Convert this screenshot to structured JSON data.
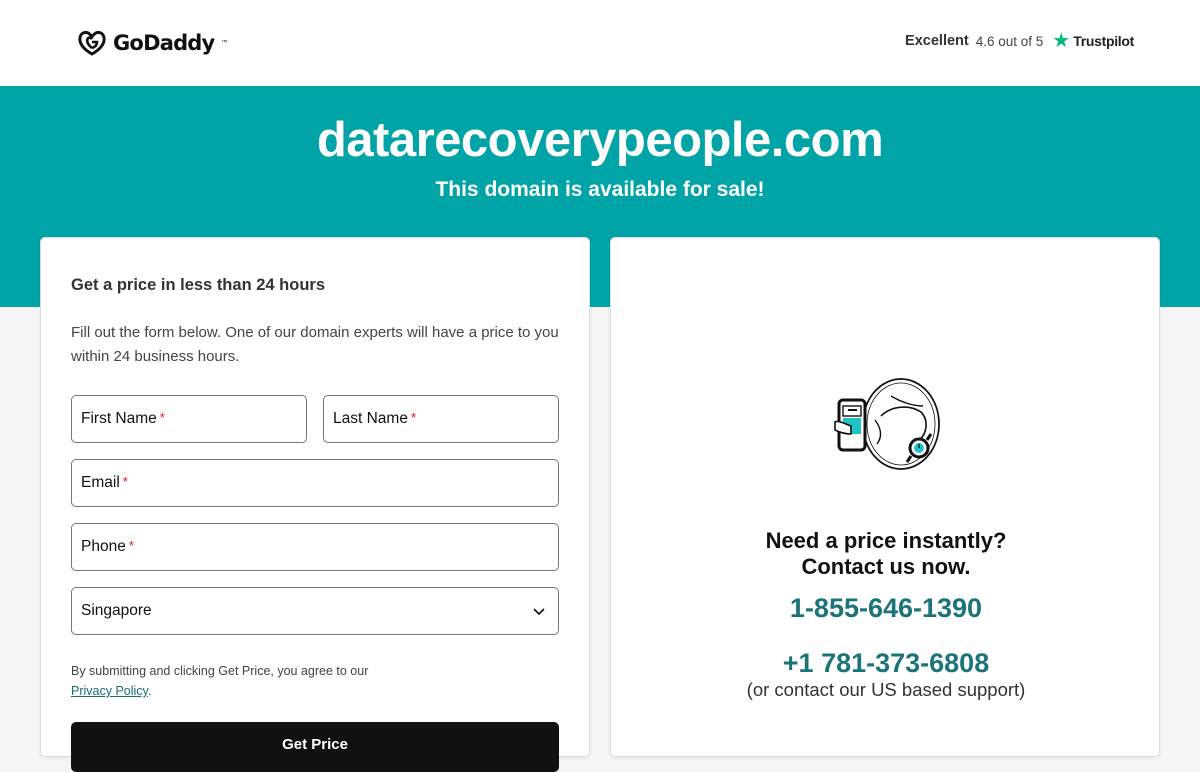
{
  "header": {
    "brand": "GoDaddy",
    "trustpilot": {
      "rating_word": "Excellent",
      "score": "4.6 out of 5",
      "brand": "Trustpilot"
    }
  },
  "hero": {
    "domain": "datarecoverypeople.com",
    "tagline": "This domain is available for sale!"
  },
  "form": {
    "title": "Get a price in less than 24 hours",
    "description": "Fill out the form below. One of our domain experts will have a price to you within 24 business hours.",
    "first_name_label": "First Name",
    "last_name_label": "Last Name",
    "email_label": "Email",
    "phone_label": "Phone",
    "required_mark": "*",
    "country_value": "Singapore",
    "consent_text": "By submitting and clicking Get Price, you agree to our",
    "privacy_link": "Privacy Policy",
    "consent_end": ".",
    "submit_label": "Get Price"
  },
  "contact": {
    "heading_line1": "Need a price instantly?",
    "heading_line2": "Contact us now.",
    "phone_primary": "1-855-646-1390",
    "phone_secondary": "+1 781-373-6808",
    "support_note": "(or contact our US based support)"
  },
  "colors": {
    "teal": "#00a4a6",
    "phone_link": "#1b7478",
    "trustpilot_green": "#00b67a"
  }
}
